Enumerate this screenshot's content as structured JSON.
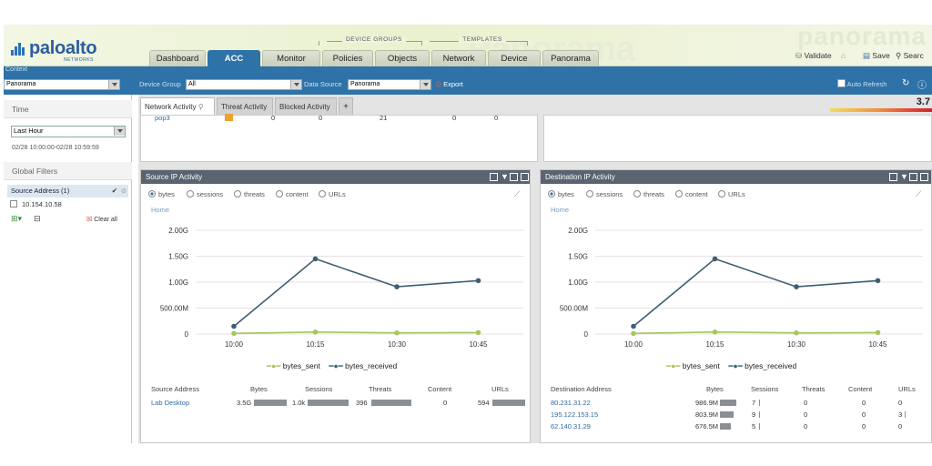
{
  "brand": {
    "logo_text": "paloalto",
    "logo_sub": "NETWORKS",
    "watermark": "panorama",
    "watermark2": "Panorama"
  },
  "nav": {
    "group_device_groups": "DEVICE GROUPS",
    "group_templates": "TEMPLATES",
    "tabs": [
      "Dashboard",
      "ACC",
      "Monitor",
      "Policies",
      "Objects",
      "Network",
      "Device",
      "Panorama"
    ],
    "active_tab": "ACC"
  },
  "header_actions": {
    "validate": "Validate",
    "save": "Save",
    "search": "Searc"
  },
  "context": {
    "label": "Context",
    "value": "Panorama"
  },
  "filters": {
    "device_group_label": "Device Group",
    "device_group_value": "All",
    "data_source_label": "Data Source",
    "data_source_value": "Panorama",
    "export_label": "Export",
    "auto_refresh_label": "Auto Refresh",
    "auto_refresh_checked": false
  },
  "sidebar": {
    "time_header": "Time",
    "time_value": "Last Hour",
    "time_range": "02/28 10:00:00-02/28 10:59:59",
    "global_filters_header": "Global Filters",
    "filter_group": "Source Address (1)",
    "filter_item": "10.154.10.58",
    "clear_all": "Clear all"
  },
  "acc_tabs": [
    "Network Activity",
    "Threat Activity",
    "Blocked Activity"
  ],
  "acc_active_tab": "Network Activity",
  "add_tab_label": "+",
  "threat_level": "3.7",
  "top_card": {
    "row_app": "pop3",
    "row_values": [
      "0",
      "0",
      "21",
      "0",
      "0"
    ]
  },
  "source_panel": {
    "title": "Source IP Activity",
    "radios": [
      "bytes",
      "sessions",
      "threats",
      "content",
      "URLs"
    ],
    "selected_radio": "bytes",
    "breadcrumb": "Home",
    "columns": [
      "Source Address",
      "Bytes",
      "Sessions",
      "Threats",
      "Content",
      "URLs"
    ],
    "rows": [
      {
        "address": "Lab Desktop",
        "bytes": "3.5G",
        "bytes_bar": 1.0,
        "sessions": "1.0k",
        "sessions_bar": 1.0,
        "threats": "396",
        "threats_bar": 1.0,
        "content": "0",
        "urls": "594",
        "urls_bar": 1.0
      }
    ]
  },
  "dest_panel": {
    "title": "Destination IP Activity",
    "radios": [
      "bytes",
      "sessions",
      "threats",
      "content",
      "URLs"
    ],
    "selected_radio": "bytes",
    "breadcrumb": "Home",
    "columns": [
      "Destination Address",
      "Bytes",
      "Sessions",
      "Threats",
      "Content",
      "URLs"
    ],
    "rows": [
      {
        "address": "80.231.31.22",
        "bytes": "986.9M",
        "bytes_bar": 1.0,
        "sessions": "7",
        "sessions_bar": 0.05,
        "threats": "0",
        "content": "0",
        "urls": "0",
        "urls_bar": 0
      },
      {
        "address": "195.122.153.15",
        "bytes": "803.9M",
        "bytes_bar": 0.81,
        "sessions": "9",
        "sessions_bar": 0.06,
        "threats": "0",
        "content": "0",
        "urls": "3",
        "urls_bar": 0.05
      },
      {
        "address": "62.140.31.29",
        "bytes": "676.5M",
        "bytes_bar": 0.69,
        "sessions": "5",
        "sessions_bar": 0.04,
        "threats": "0",
        "content": "0",
        "urls": "0",
        "urls_bar": 0
      }
    ]
  },
  "chart_data": [
    {
      "type": "line",
      "title": "Source IP Activity",
      "x": [
        "10:00",
        "10:15",
        "10:30",
        "10:45"
      ],
      "y_ticks": [
        "0",
        "500.00M",
        "1.00G",
        "1.50G",
        "2.00G"
      ],
      "ylim": [
        0,
        2000000000
      ],
      "series": [
        {
          "name": "bytes_sent",
          "color": "#a8c65a",
          "values": [
            12000000,
            38000000,
            22000000,
            28000000
          ]
        },
        {
          "name": "bytes_received",
          "color": "#3e5f72",
          "values": [
            150000000,
            1450000000,
            910000000,
            1030000000
          ]
        }
      ],
      "legend": "bottom",
      "grid": true
    },
    {
      "type": "line",
      "title": "Destination IP Activity",
      "x": [
        "10:00",
        "10:15",
        "10:30",
        "10:45"
      ],
      "y_ticks": [
        "0",
        "500.00M",
        "1.00G",
        "1.50G",
        "2.00G"
      ],
      "ylim": [
        0,
        2000000000
      ],
      "series": [
        {
          "name": "bytes_sent",
          "color": "#a8c65a",
          "values": [
            12000000,
            38000000,
            22000000,
            28000000
          ]
        },
        {
          "name": "bytes_received",
          "color": "#3e5f72",
          "values": [
            150000000,
            1450000000,
            910000000,
            1030000000
          ]
        }
      ],
      "legend": "bottom",
      "grid": true
    }
  ]
}
